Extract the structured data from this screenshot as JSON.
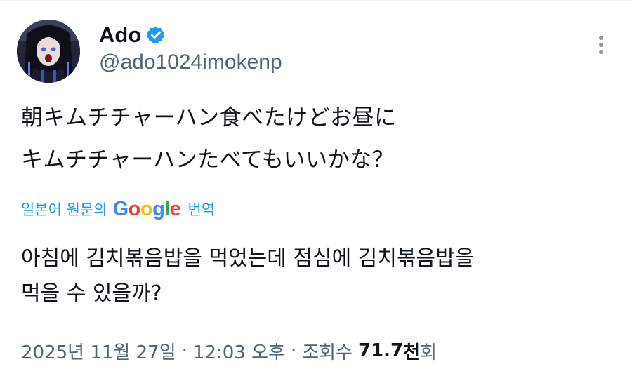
{
  "author": {
    "display_name": "Ado",
    "handle": "@ado1024imokenp",
    "verified": true,
    "verified_color": "#1d9bf0",
    "avatar_icon": "avatar-illustration"
  },
  "menu": {
    "icon": "more-vertical-icon"
  },
  "tweet": {
    "lines": [
      "朝キムチチャーハン食べたけどお昼に",
      "キムチチャーハンたべてもいいかな？"
    ]
  },
  "translation": {
    "source_label": "일본어 원문의",
    "provider": {
      "letters": [
        "G",
        "o",
        "o",
        "g",
        "l",
        "e"
      ]
    },
    "action_label": "번역",
    "accent_color": "#1d9bf0",
    "lines": [
      "아침에 김치볶음밥을 먹었는데 점심에 김치볶음밥을",
      "먹을 수 있을까?"
    ]
  },
  "meta": {
    "date": "2025년 11월 27일",
    "separator": "·",
    "time": "12:03 오후",
    "views_label": "조회수",
    "views_number": "71.7",
    "views_unit_bold": "천",
    "views_suffix": "회"
  }
}
